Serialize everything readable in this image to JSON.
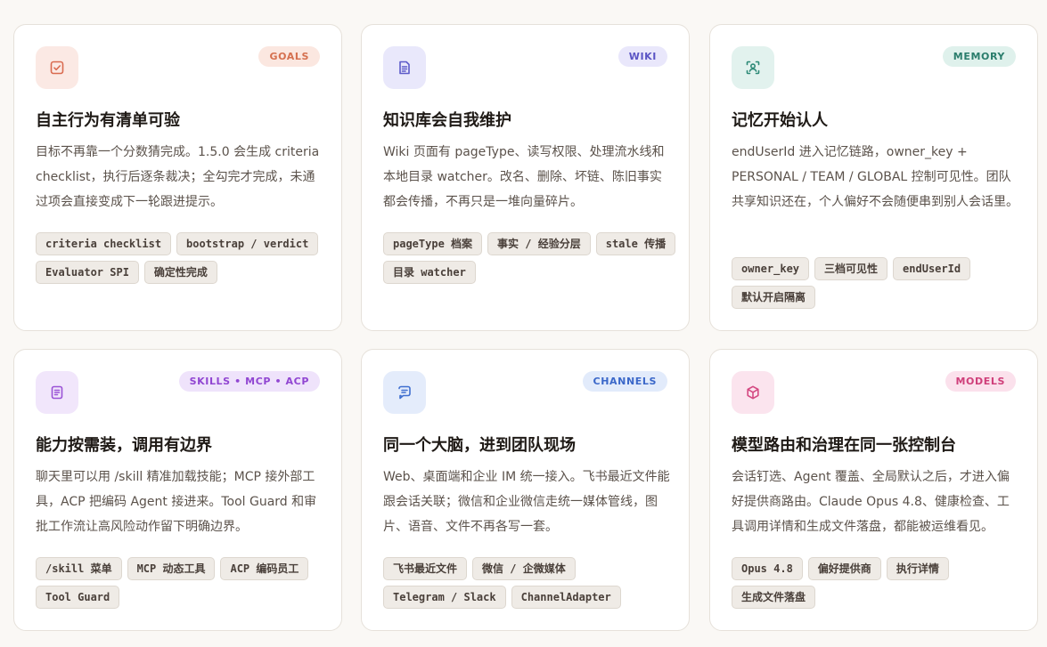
{
  "cards": [
    {
      "badge": "GOALS",
      "icon": "checkbox-icon",
      "title": "自主行为有清单可验",
      "desc": "目标不再靠一个分数猜完成。1.5.0 会生成 criteria checklist，执行后逐条裁决；全勾完才完成，未通过项会直接变成下一轮跟进提示。",
      "tags": [
        "criteria checklist",
        "bootstrap / verdict",
        "Evaluator SPI",
        "确定性完成"
      ],
      "colors": {
        "icon_bg": "#fbe9e4",
        "icon_fg": "#d96a4f",
        "badge_bg": "#fbe7e0",
        "badge_fg": "#d5704f"
      }
    },
    {
      "badge": "WIKI",
      "icon": "document-icon",
      "title": "知识库会自我维护",
      "desc": "Wiki 页面有 pageType、读写权限、处理流水线和本地目录 watcher。改名、删除、坏链、陈旧事实都会传播，不再只是一堆向量碎片。",
      "tags": [
        "pageType 档案",
        "事实 / 经验分层",
        "stale 传播",
        "目录 watcher"
      ],
      "colors": {
        "icon_bg": "#e9e8fb",
        "icon_fg": "#5d5bc9",
        "badge_bg": "#e9e7fb",
        "badge_fg": "#5a54c4"
      }
    },
    {
      "badge": "MEMORY",
      "icon": "user-scan-icon",
      "title": "记忆开始认人",
      "desc": "endUserId 进入记忆链路，owner_key + PERSONAL / TEAM / GLOBAL 控制可见性。团队共享知识还在，个人偏好不会随便串到别人会话里。",
      "tags": [
        "owner_key",
        "三档可见性",
        "endUserId",
        "默认开启隔离"
      ],
      "colors": {
        "icon_bg": "#e2f2ee",
        "icon_fg": "#2d8a77",
        "badge_bg": "#dff1ec",
        "badge_fg": "#2a7d6c"
      }
    },
    {
      "badge": "SKILLS • MCP • ACP",
      "icon": "clipboard-icon",
      "title": "能力按需装，调用有边界",
      "desc": "聊天里可以用 /skill 精准加载技能；MCP 接外部工具，ACP 把编码 Agent 接进来。Tool Guard 和审批工作流让高风险动作留下明确边界。",
      "tags": [
        "/skill 菜单",
        "MCP 动态工具",
        "ACP 编码员工",
        "Tool Guard"
      ],
      "colors": {
        "icon_bg": "#f1e6fb",
        "icon_fg": "#9a52d6",
        "badge_bg": "#efe3fb",
        "badge_fg": "#9146d2"
      }
    },
    {
      "badge": "CHANNELS",
      "icon": "chat-icon",
      "title": "同一个大脑，进到团队现场",
      "desc": "Web、桌面端和企业 IM 统一接入。飞书最近文件能跟会话关联；微信和企业微信走统一媒体管线，图片、语音、文件不再各写一套。",
      "tags": [
        "飞书最近文件",
        "微信 / 企微媒体",
        "Telegram / Slack",
        "ChannelAdapter"
      ],
      "colors": {
        "icon_bg": "#e4ecfb",
        "icon_fg": "#3f6fd0",
        "badge_bg": "#e2ebfb",
        "badge_fg": "#3a67c9"
      }
    },
    {
      "badge": "MODELS",
      "icon": "cube-icon",
      "title": "模型路由和治理在同一张控制台",
      "desc": "会话钉选、Agent 覆盖、全局默认之后，才进入偏好提供商路由。Claude Opus 4.8、健康检查、工具调用详情和生成文件落盘，都能被运维看见。",
      "tags": [
        "Opus 4.8",
        "偏好提供商",
        "执行详情",
        "生成文件落盘"
      ],
      "colors": {
        "icon_bg": "#fbe4ee",
        "icon_fg": "#d44982",
        "badge_bg": "#fbe1ec",
        "badge_fg": "#cf3f7a"
      }
    }
  ]
}
